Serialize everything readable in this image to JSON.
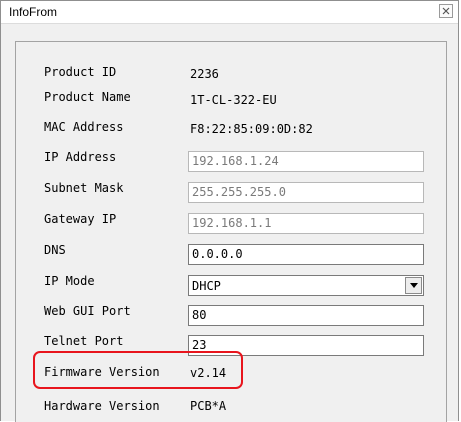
{
  "window": {
    "title": "InfoFrom"
  },
  "fields": {
    "product_id": {
      "label": "Product ID",
      "value": "2236"
    },
    "product_name": {
      "label": "Product Name",
      "value": "1T-CL-322-EU"
    },
    "mac_address": {
      "label": "MAC Address",
      "value": "F8:22:85:09:0D:82"
    },
    "ip_address": {
      "label": "IP Address",
      "value": "192.168.1.24"
    },
    "subnet_mask": {
      "label": "Subnet Mask",
      "value": "255.255.255.0"
    },
    "gateway_ip": {
      "label": "Gateway IP",
      "value": "192.168.1.1"
    },
    "dns": {
      "label": "DNS",
      "value": "0.0.0.0"
    },
    "ip_mode": {
      "label": "IP Mode",
      "value": "DHCP"
    },
    "web_gui_port": {
      "label": "Web GUI Port",
      "value": "80"
    },
    "telnet_port": {
      "label": "Telnet Port",
      "value": "23"
    },
    "firmware_version": {
      "label": "Firmware Version",
      "value": "v2.14"
    },
    "hardware_version": {
      "label": "Hardware Version",
      "value": "PCB*A"
    }
  },
  "colors": {
    "highlight": "#e8151d"
  }
}
